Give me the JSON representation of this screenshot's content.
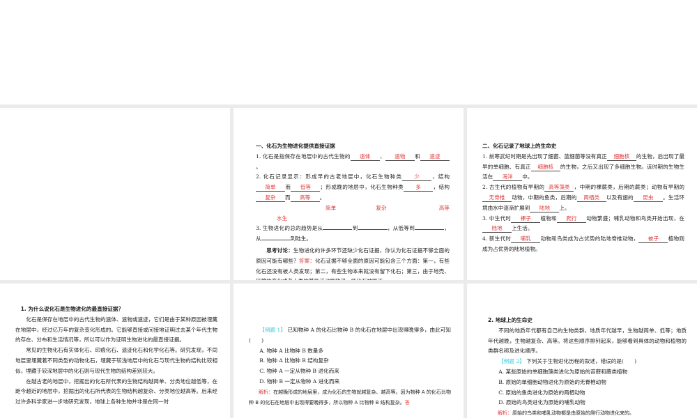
{
  "panel2": {
    "title": "一、化石为生物进化提供直接证据",
    "lines": [
      [
        {
          "t": "1. 化石是指保存在地层中的古代生物的"
        },
        {
          "a": "遗体"
        },
        {
          "t": "、"
        },
        {
          "a": "遗物"
        },
        {
          "t": "和"
        },
        {
          "a": "遗迹"
        },
        {
          "t": "。"
        }
      ],
      [
        {
          "t": "2. 化石记录显示：形成早的古老地层中，化石生物种类"
        },
        {
          "a": "少"
        },
        {
          "t": "，结构"
        },
        {
          "a": "简单"
        },
        {
          "t": "而"
        },
        {
          "a": "低等"
        },
        {
          "t": "；形成晚的地层中，化石生物种类"
        },
        {
          "a": "多"
        },
        {
          "t": "，结构"
        },
        {
          "a": "复杂"
        },
        {
          "t": "而"
        },
        {
          "a": "高等"
        },
        {
          "t": "。"
        }
      ]
    ],
    "answer_row": [
      "简单",
      "复杂",
      "高等",
      "水生"
    ],
    "item3": [
      {
        "t": "3. 生物进化的总的趋势是从"
      },
      {
        "a": ""
      },
      {
        "t": "到"
      },
      {
        "a": ""
      },
      {
        "t": "，从低等到"
      },
      {
        "a": ""
      },
      {
        "t": "，从"
      },
      {
        "a": ""
      },
      {
        "t": "到陆生。"
      }
    ],
    "discussion_label": "思考讨论：",
    "discussion": "生物进化的许多环节还缺少化石证据，你认为化石证据不够全面的原因可能有哪些？",
    "answer_label": "答案：",
    "answer": "化石证据不够全面的原因可能包含三个方面：第一，有些化石还没有被人类发现；第二，有些生物本来就没有留下化石；第三，由于地壳、环境的变化或者人类的某些活动导致了一些化石被毁灭。"
  },
  "panel3": {
    "title": "二、化石记录了地球上的生命史",
    "lines": [
      [
        {
          "t": "1. 前寒武纪时期是先出现了细菌、蓝细菌等没有真正"
        },
        {
          "a": "细胞核"
        },
        {
          "t": "的生物，后出现了最早的单细胞、有真正"
        },
        {
          "a": "细胞核"
        },
        {
          "t": "的生物，之后又出现了多细胞生物。该时期的生物生活在"
        },
        {
          "a": "海洋"
        },
        {
          "t": "中。"
        }
      ],
      [
        {
          "t": "2. 古生代的植物有早期的"
        },
        {
          "a": "高等藻类"
        },
        {
          "t": "，中期的裸蕨类，后期的蕨类；动物有早期的"
        },
        {
          "a": "无脊椎"
        },
        {
          "t": "动物，中期的鱼类，后期的"
        },
        {
          "a": "两栖类"
        },
        {
          "t": "以及有翅的"
        },
        {
          "a": "昆虫"
        },
        {
          "t": "。生活环境由水中逐渐扩展到"
        },
        {
          "a": "陆地"
        },
        {
          "t": "上。"
        }
      ],
      [
        {
          "t": "3. 中生代时"
        },
        {
          "a": "裸子"
        },
        {
          "t": "植物和"
        },
        {
          "a": "爬行"
        },
        {
          "t": "动物繁盛；哺乳动物和鸟类开始出现，在"
        },
        {
          "a": "陆地"
        },
        {
          "t": "上生活。"
        }
      ],
      [
        {
          "t": "4. 新生代时"
        },
        {
          "a": "哺乳"
        },
        {
          "t": "动物和鸟类成为占优势的陆地脊椎动物，"
        },
        {
          "a": "被子"
        },
        {
          "t": "植物则成为占优势的陆地植物。"
        }
      ]
    ]
  },
  "panel4": {
    "title": "1. 为什么说化石是生物进化的最直接证据？",
    "paras": [
      "化石是保存在地层中的古代生物的遗体、遗物或遗迹，它们是由于某种原因被埋藏在地层中，经过亿万年的复杂变化形成的。它能够直接或间接地证明过去某个年代生物的存在、分布和生活情况等，所以可以作为证明生物进化的最直接证据。",
      "常见的生物化石有实体化石、印痕化石、遗迹化石和化学化石等。研究发现，不同地层里埋藏着不同类型的动物化石，埋藏于较浅地层中的化石与现代生物的结构比较相似，埋藏于较深地层中的化石则与现代生物的结构差别较大。",
      "在越古老的地层中，挖掘出的化石所代表的生物结构越简单、分类地位越低等，在距今越近的地层中，挖掘出的化石所代表的生物结构越复杂、分类地位越高等。后来经过许多科学家进一步地研究发现，地球上各种生物并非是在同一时"
    ]
  },
  "panel5": {
    "tag": "【例题 1】",
    "question": "已知物种 A 的化石比物种 B 的化石在地层中出现得晚得多，由此可知(　　)",
    "options": [
      "A. 物种 A 比物种 B 数量多",
      "B. 物种 A 比物种 B 结构复杂",
      "C. 物种 A 一定从物种 B 进化而来",
      "D. 物种 B 一定从物种 A 进化而来"
    ],
    "analysis_label": "解析：",
    "analysis": "在越晚形成的地层里，成为化石的生物就越复杂、越高等。因为物种 A 的化石比物种 B 的化石在地层中出现得要晚得多，所以物种 A 比物种 B 结构复杂。",
    "answer_label": "答"
  },
  "panel6": {
    "title": "2. 地球上的生命史",
    "para": "不同的地质年代都有自己的生物类群，地质年代越早，生物越简单、低等；地质年代越晚，生物越复杂、高等。将这些顺序排列起来，能够看到具体的动物和植物的类群名称及进化顺序。",
    "tag": "【例题 2】",
    "question": "下列关于生物进化历程的叙述，错误的是(　　)",
    "options": [
      "A. 某些原始的单细胞藻类进化为原始的苔藓和蕨类植物",
      "B. 原始的单细胞动物进化为原始的无脊椎动物",
      "C. 原始的鱼类进化为原始的两栖动物",
      "D. 原始的鸟类进化为原始的哺乳动物"
    ],
    "analysis_label": "解析：",
    "analysis": "原始的鸟类和哺乳动物都是由原始的爬行动物进化来的。"
  }
}
